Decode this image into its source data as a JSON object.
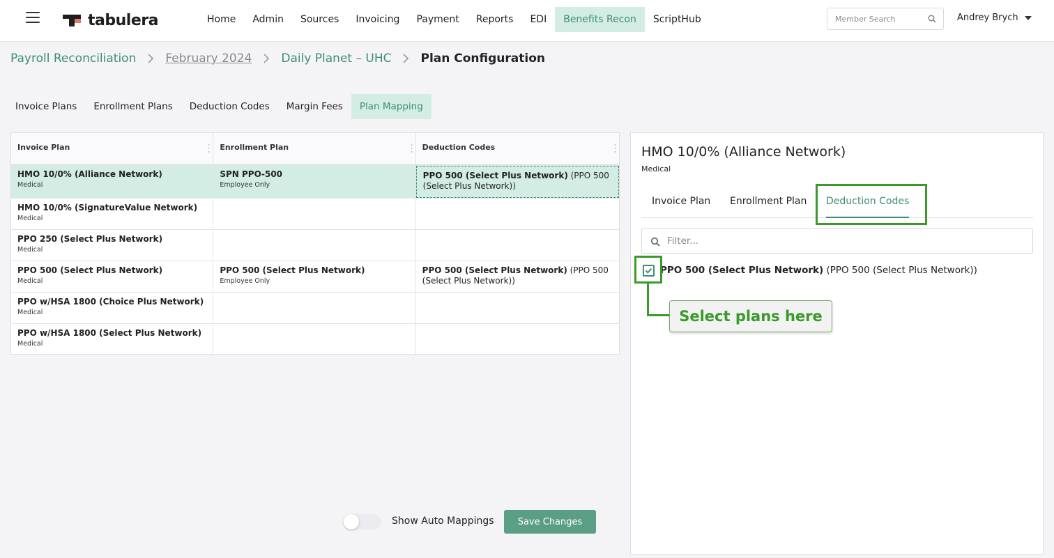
{
  "app": {
    "logo_text": "tabulera"
  },
  "nav": {
    "items": [
      {
        "label": "Home"
      },
      {
        "label": "Admin"
      },
      {
        "label": "Sources"
      },
      {
        "label": "Invoicing"
      },
      {
        "label": "Payment"
      },
      {
        "label": "Reports"
      },
      {
        "label": "EDI"
      },
      {
        "label": "Benefits Recon",
        "active": true
      },
      {
        "label": "ScriptHub"
      }
    ],
    "search_placeholder": "Member Search",
    "user_name": "Andrey Brych"
  },
  "breadcrumb": {
    "items": [
      "Payroll Reconciliation",
      "February 2024",
      "Daily Planet – UHC"
    ],
    "current": "Plan Configuration"
  },
  "subtabs": [
    "Invoice Plans",
    "Enrollment Plans",
    "Deduction Codes",
    "Margin Fees",
    "Plan Mapping"
  ],
  "subtab_active": "Plan Mapping",
  "grid": {
    "columns": [
      "Invoice Plan",
      "Enrollment Plan",
      "Deduction Codes"
    ],
    "rows": [
      {
        "invoice": "HMO 10/0% (Alliance Network)",
        "invoice_type": "Medical",
        "enroll": "SPN PPO-500",
        "enroll_type": "Employee Only",
        "deduction_bold": "PPO 500 (Select Plus Network)",
        "deduction_rest": " (PPO 500 (Select Plus Network))",
        "selected": true
      },
      {
        "invoice": "HMO 10/0% (SignatureValue Network)",
        "invoice_type": "Medical",
        "enroll": "",
        "enroll_type": "",
        "deduction_bold": "",
        "deduction_rest": ""
      },
      {
        "invoice": "PPO 250 (Select Plus Network)",
        "invoice_type": "Medical",
        "enroll": "",
        "enroll_type": "",
        "deduction_bold": "",
        "deduction_rest": ""
      },
      {
        "invoice": "PPO 500 (Select Plus Network)",
        "invoice_type": "Medical",
        "enroll": "PPO 500 (Select Plus Network)",
        "enroll_type": "Employee Only",
        "deduction_bold": "PPO 500 (Select Plus Network)",
        "deduction_rest": " (PPO 500 (Select Plus Network))"
      },
      {
        "invoice": "PPO w/HSA 1800 (Choice Plus Network)",
        "invoice_type": "Medical",
        "enroll": "",
        "enroll_type": "",
        "deduction_bold": "",
        "deduction_rest": ""
      },
      {
        "invoice": "PPO w/HSA 1800 (Select Plus Network)",
        "invoice_type": "Medical",
        "enroll": "",
        "enroll_type": "",
        "deduction_bold": "",
        "deduction_rest": ""
      }
    ]
  },
  "controls": {
    "toggle_label": "Show Auto Mappings",
    "toggle_on": false,
    "save_label": "Save Changes"
  },
  "panel": {
    "title": "HMO 10/0% (Alliance Network)",
    "subtitle": "Medical",
    "tabs": [
      "Invoice Plan",
      "Enrollment Plan",
      "Deduction Codes"
    ],
    "active_tab": "Deduction Codes",
    "filter_placeholder": "Filter...",
    "option": {
      "bold": "PPO 500 (Select Plus Network)",
      "rest": " (PPO 500 (Select Plus Network))",
      "checked": true
    },
    "callout": "Select plans here"
  },
  "colors": {
    "accent": "#3e8c75",
    "accent_bg": "#d3ede5",
    "button": "#5a9e85",
    "annotation": "#3a9a2a"
  }
}
